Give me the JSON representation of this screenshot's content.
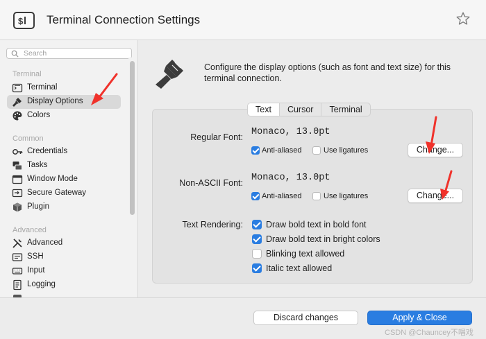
{
  "window": {
    "title": "Terminal Connection Settings"
  },
  "search": {
    "placeholder": "Search"
  },
  "sidebar": {
    "sections": [
      {
        "title": "Terminal",
        "items": [
          {
            "label": "Terminal",
            "icon": "terminal-icon"
          },
          {
            "label": "Display Options",
            "icon": "brush-icon",
            "selected": true
          },
          {
            "label": "Colors",
            "icon": "palette-icon"
          }
        ]
      },
      {
        "title": "Common",
        "items": [
          {
            "label": "Credentials",
            "icon": "key-icon"
          },
          {
            "label": "Tasks",
            "icon": "tasks-icon"
          },
          {
            "label": "Window Mode",
            "icon": "window-icon"
          },
          {
            "label": "Secure Gateway",
            "icon": "gateway-icon"
          },
          {
            "label": "Plugin",
            "icon": "cube-icon"
          }
        ]
      },
      {
        "title": "Advanced",
        "items": [
          {
            "label": "Advanced",
            "icon": "tools-icon"
          },
          {
            "label": "SSH",
            "icon": "ssh-icon"
          },
          {
            "label": "Input",
            "icon": "keyboard-icon"
          },
          {
            "label": "Logging",
            "icon": "logging-icon"
          }
        ]
      }
    ]
  },
  "main": {
    "description": "Configure the display options (such as font and text size) for this terminal connection.",
    "tabs": [
      {
        "label": "Text",
        "active": true
      },
      {
        "label": "Cursor",
        "active": false
      },
      {
        "label": "Terminal",
        "active": false
      }
    ],
    "regular_font": {
      "label": "Regular Font:",
      "value": "Monaco, 13.0pt",
      "anti_aliased": {
        "label": "Anti-aliased",
        "checked": true
      },
      "ligatures": {
        "label": "Use ligatures",
        "checked": false
      },
      "change_label": "Change..."
    },
    "non_ascii_font": {
      "label": "Non-ASCII Font:",
      "value": "Monaco, 13.0pt",
      "anti_aliased": {
        "label": "Anti-aliased",
        "checked": true
      },
      "ligatures": {
        "label": "Use ligatures",
        "checked": false
      },
      "change_label": "Change..."
    },
    "text_rendering": {
      "label": "Text Rendering:",
      "options": [
        {
          "label": "Draw bold text in bold font",
          "checked": true
        },
        {
          "label": "Draw bold text in bright colors",
          "checked": true
        },
        {
          "label": "Blinking text allowed",
          "checked": false
        },
        {
          "label": "Italic text allowed",
          "checked": true
        }
      ]
    }
  },
  "footer": {
    "discard_label": "Discard changes",
    "apply_label": "Apply & Close",
    "watermark": "CSDN @Chauncey不唱戏"
  },
  "colors": {
    "accent": "#2a7de1",
    "annotation_arrow": "#f0322b"
  }
}
